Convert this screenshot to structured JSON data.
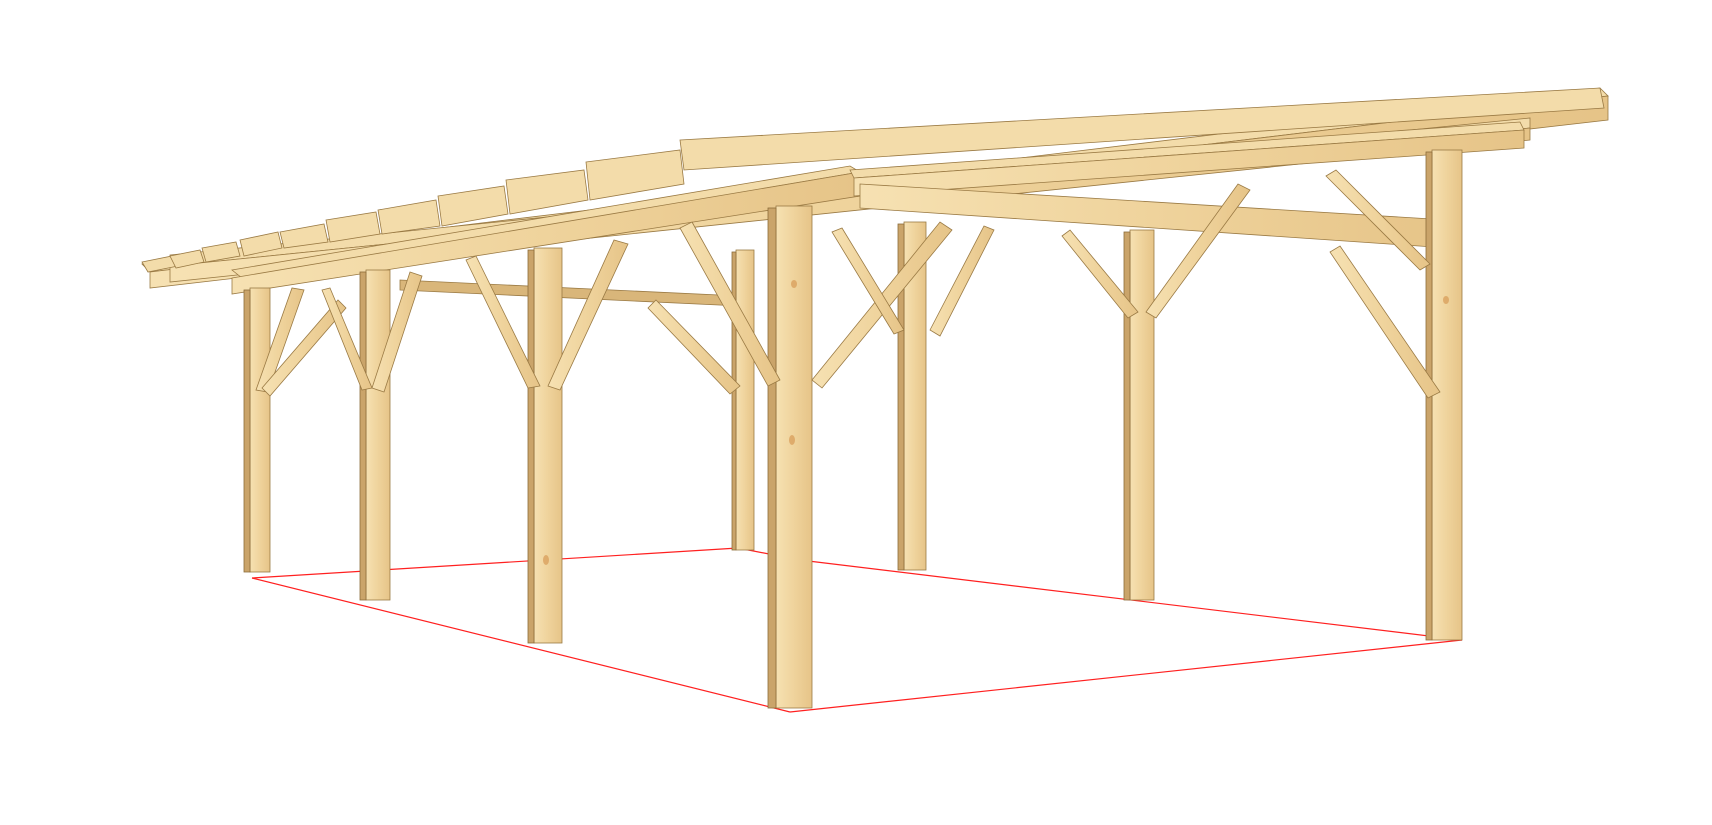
{
  "scene": {
    "subject": "wooden-carport-frame",
    "footprint_color": "#ff2020",
    "wood_light": "#f6dfac",
    "wood_mid": "#e8c68a",
    "wood_dark": "#caa46a",
    "background": "#ffffff"
  }
}
